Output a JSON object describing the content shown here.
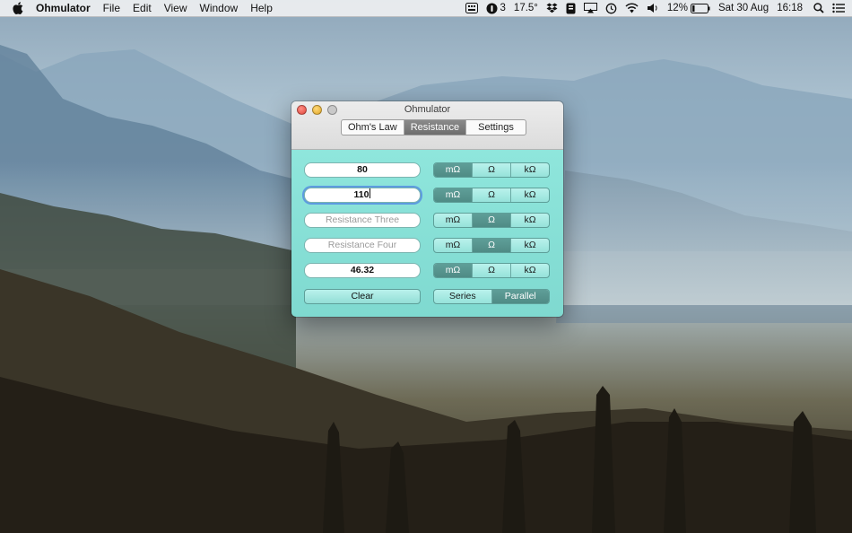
{
  "menubar": {
    "app_name": "Ohmulator",
    "menus": [
      "File",
      "Edit",
      "View",
      "Window",
      "Help"
    ],
    "status": {
      "notifications_count": "3",
      "temperature": "17.5°",
      "battery": "12%",
      "date": "Sat 30 Aug",
      "time": "16:18"
    }
  },
  "window": {
    "title": "Ohmulator",
    "tabs": [
      {
        "label": "Ohm's Law",
        "selected": false
      },
      {
        "label": "Resistance",
        "selected": true
      },
      {
        "label": "Settings",
        "selected": false
      }
    ],
    "rows": [
      {
        "value": "80",
        "placeholder": "",
        "units": [
          "mΩ",
          "Ω",
          "kΩ"
        ],
        "selected_unit": "mΩ"
      },
      {
        "value": "110",
        "placeholder": "",
        "units": [
          "mΩ",
          "Ω",
          "kΩ"
        ],
        "selected_unit": "mΩ"
      },
      {
        "value": "",
        "placeholder": "Resistance Three",
        "units": [
          "mΩ",
          "Ω",
          "kΩ"
        ],
        "selected_unit": "Ω"
      },
      {
        "value": "",
        "placeholder": "Resistance Four",
        "units": [
          "mΩ",
          "Ω",
          "kΩ"
        ],
        "selected_unit": "Ω"
      },
      {
        "value": "46.32",
        "placeholder": "",
        "units": [
          "mΩ",
          "Ω",
          "kΩ"
        ],
        "selected_unit": "mΩ"
      }
    ],
    "clear_label": "Clear",
    "mode": {
      "options": [
        "Series",
        "Parallel"
      ],
      "selected": "Parallel"
    }
  },
  "colors": {
    "content_bg": "#8fe6dc",
    "segment_selected": "#5f9e98",
    "tab_selected": "#7a7a7a"
  }
}
